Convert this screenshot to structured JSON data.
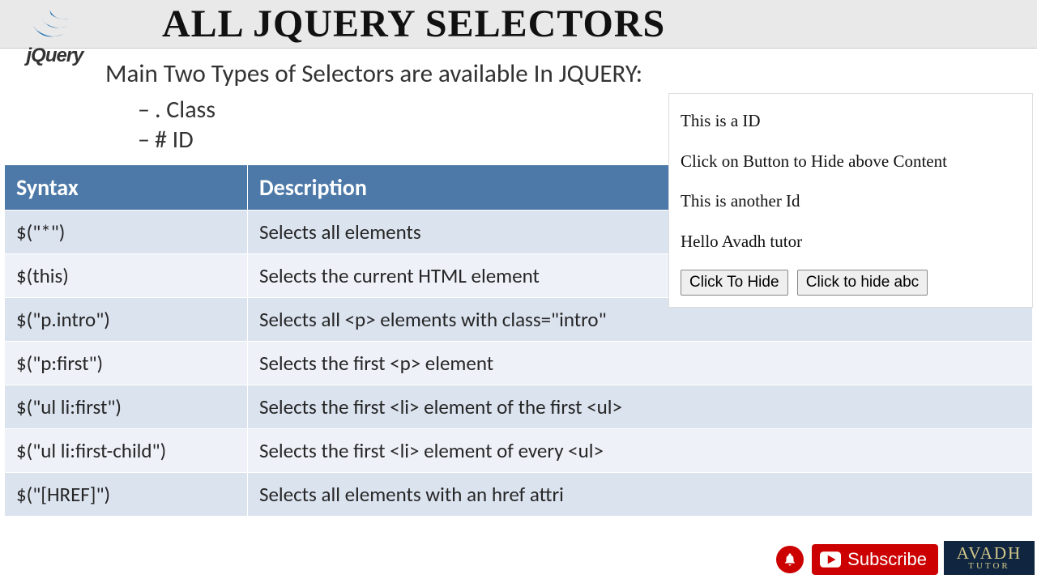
{
  "header": {
    "title": "ALL JQUERY SELECTORS",
    "logo_text": "jQuery"
  },
  "subtitle": "Main Two Types of Selectors are available In JQUERY:",
  "bullets": [
    ". Class",
    "# ID"
  ],
  "table": {
    "headers": [
      "Syntax",
      "Description"
    ],
    "rows": [
      {
        "syntax": "$(\"*\")",
        "desc": "Selects all elements"
      },
      {
        "syntax": "$(this)",
        "desc": "Selects the current HTML element"
      },
      {
        "syntax": "$(\"p.intro\")",
        "desc": "Selects all <p> elements with class=\"intro\""
      },
      {
        "syntax": "$(\"p:first\")",
        "desc": "Selects the first <p> element"
      },
      {
        "syntax": "$(\"ul li:first\")",
        "desc": "Selects the first <li> element of the first <ul>"
      },
      {
        "syntax": "$(\"ul li:first-child\")",
        "desc": "Selects the first <li> element of every <ul>"
      },
      {
        "syntax": "$(\"[HREF]\")",
        "desc": "Selects all elements with an href attri"
      }
    ]
  },
  "demo": {
    "line1": "This is a ID",
    "line2": "Click on Button to Hide above Content",
    "line3": "This is another Id",
    "line4": "Hello Avadh tutor",
    "btn1": "Click To Hide",
    "btn2": "Click to hide abc"
  },
  "subscribe": {
    "label": "Subscribe"
  },
  "badge": {
    "l1": "AVADH",
    "l2": "TUTOR"
  }
}
